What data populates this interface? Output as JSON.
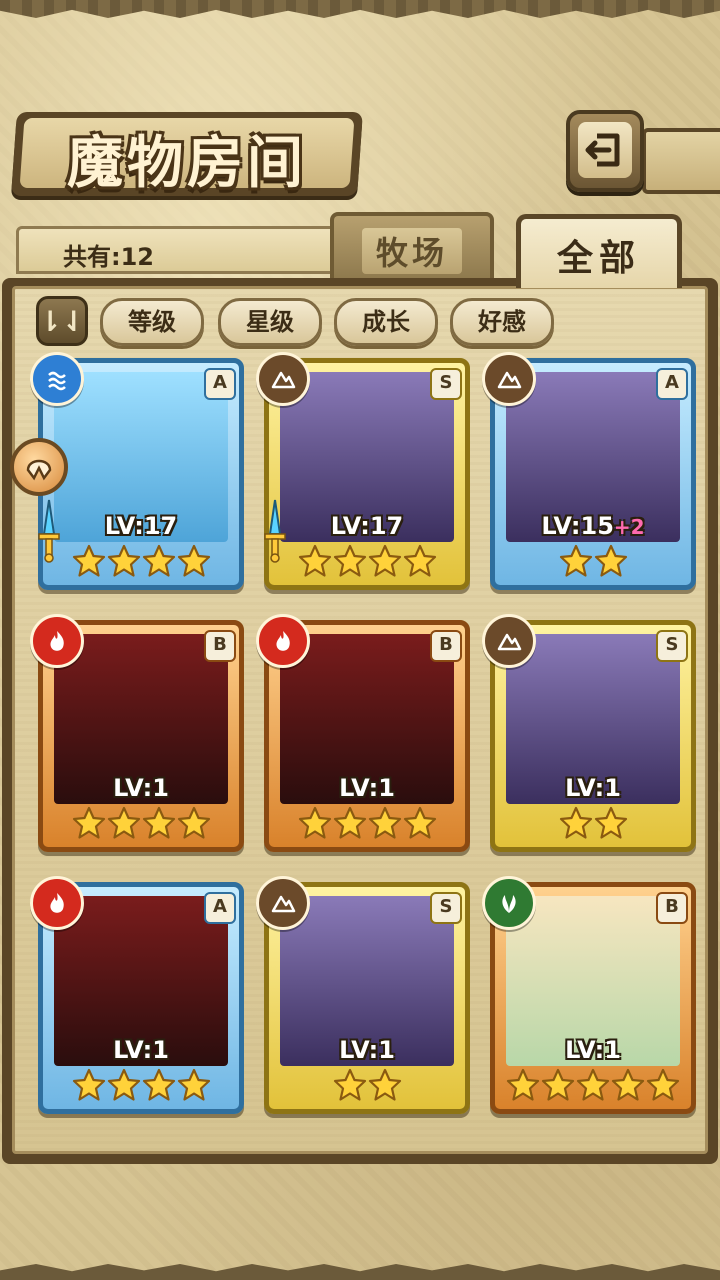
{
  "title": "魔物房间",
  "count_label": "共有:12",
  "tabs": {
    "ranch": "牧场",
    "all": "全部"
  },
  "filters": [
    "等级",
    "星级",
    "成长",
    "好感"
  ],
  "sort_toggle_label": "⇂⇃",
  "colors": {
    "water": "#2e7fd4",
    "earth": "#6b4a2a",
    "fire": "#d42a1e",
    "wind": "#2f7a32",
    "frame_blue": "#6fb6e4",
    "frame_gold": "#e2c23a",
    "frame_orange": "#d9822b"
  },
  "cards": [
    {
      "rank": "A",
      "element": "water",
      "level": "LV:17",
      "bonus": "",
      "stars": 4,
      "frame": "blue",
      "equipped": true
    },
    {
      "rank": "S",
      "element": "earth",
      "level": "LV:17",
      "bonus": "",
      "stars": 4,
      "frame": "gold",
      "equipped": true
    },
    {
      "rank": "A",
      "element": "earth",
      "level": "LV:15",
      "bonus": "+2",
      "stars": 2,
      "frame": "blue",
      "equipped": false
    },
    {
      "rank": "B",
      "element": "fire",
      "level": "LV:1",
      "bonus": "",
      "stars": 4,
      "frame": "orange",
      "equipped": false
    },
    {
      "rank": "B",
      "element": "fire",
      "level": "LV:1",
      "bonus": "",
      "stars": 4,
      "frame": "orange",
      "equipped": false
    },
    {
      "rank": "S",
      "element": "earth",
      "level": "LV:1",
      "bonus": "",
      "stars": 2,
      "frame": "gold",
      "equipped": false
    },
    {
      "rank": "A",
      "element": "fire",
      "level": "LV:1",
      "bonus": "",
      "stars": 4,
      "frame": "blue",
      "equipped": false
    },
    {
      "rank": "S",
      "element": "earth",
      "level": "LV:1",
      "bonus": "",
      "stars": 2,
      "frame": "gold",
      "equipped": false
    },
    {
      "rank": "B",
      "element": "wind",
      "level": "LV:1",
      "bonus": "",
      "stars": 5,
      "frame": "orange",
      "equipped": false
    }
  ]
}
